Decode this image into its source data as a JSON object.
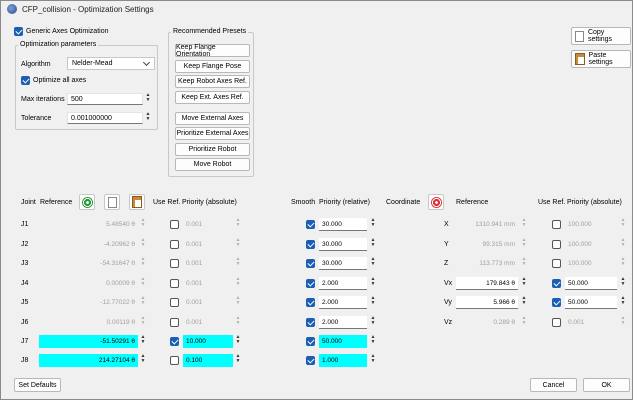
{
  "window": {
    "title": "CFP_collision - Optimization Settings"
  },
  "generic": {
    "label": "Generic Axes Optimization",
    "checked": true
  },
  "opt_params": {
    "group_label": "Optimization parameters",
    "algorithm_label": "Algorithm",
    "algorithm_value": "Nelder-Mead",
    "optimize_all_label": "Optimize all axes",
    "max_iter_label": "Max iterations",
    "max_iter_value": "500",
    "tolerance_label": "Tolerance",
    "tolerance_value": "0.001000000"
  },
  "presets": {
    "group_label": "Recommended Presets",
    "buttons": [
      "Keep Flange Orientation",
      "Keep Flange Pose",
      "Keep Robot Axes Ref.",
      "Keep Ext. Axes Ref.",
      "Move External Axes",
      "Prioritize External Axes",
      "Prioritize Robot",
      "Move Robot"
    ]
  },
  "side_buttons": {
    "copy": "Copy settings",
    "paste": "Paste settings"
  },
  "joint_headers": {
    "joint": "Joint",
    "reference": "Reference",
    "use_ref": "Use Ref.",
    "priority_abs": "Priority (absolute)",
    "smooth": "Smooth",
    "priority_rel": "Priority (relative)"
  },
  "coord_headers": {
    "coordinate": "Coordinate",
    "reference": "Reference",
    "use_ref": "Use Ref.",
    "priority_abs": "Priority (absolute)"
  },
  "joints": [
    {
      "name": "J1",
      "ref": "5.48540 θ",
      "use_ref": false,
      "prio_abs": "0.001",
      "smooth": true,
      "prio_rel": "30.000",
      "active": false
    },
    {
      "name": "J2",
      "ref": "-4.20962 θ",
      "use_ref": false,
      "prio_abs": "0.001",
      "smooth": true,
      "prio_rel": "30.000",
      "active": false
    },
    {
      "name": "J3",
      "ref": "-54.31647 θ",
      "use_ref": false,
      "prio_abs": "0.001",
      "smooth": true,
      "prio_rel": "30.000",
      "active": false
    },
    {
      "name": "J4",
      "ref": "0.00009 θ",
      "use_ref": false,
      "prio_abs": "0.001",
      "smooth": true,
      "prio_rel": "2.000",
      "active": false
    },
    {
      "name": "J5",
      "ref": "-12.77022 θ",
      "use_ref": false,
      "prio_abs": "0.001",
      "smooth": true,
      "prio_rel": "2.000",
      "active": false
    },
    {
      "name": "J6",
      "ref": "0.00119 θ",
      "use_ref": false,
      "prio_abs": "0.001",
      "smooth": true,
      "prio_rel": "2.000",
      "active": false
    },
    {
      "name": "J7",
      "ref": "-51.50291 θ",
      "use_ref": true,
      "prio_abs": "10.000",
      "smooth": true,
      "prio_rel": "50.000",
      "active": true
    },
    {
      "name": "J8",
      "ref": "214.27104 θ",
      "use_ref": false,
      "prio_abs": "0.100",
      "smooth": true,
      "prio_rel": "1.000",
      "active": true
    }
  ],
  "coords": [
    {
      "name": "X",
      "ref": "1310.941 mm",
      "use_ref": false,
      "prio_abs": "100.000",
      "active": false
    },
    {
      "name": "Y",
      "ref": "99.315 mm",
      "use_ref": false,
      "prio_abs": "100.000",
      "active": false
    },
    {
      "name": "Z",
      "ref": "113.773 mm",
      "use_ref": false,
      "prio_abs": "100.000",
      "active": false
    },
    {
      "name": "Vx",
      "ref": "179.843 θ",
      "use_ref": true,
      "prio_abs": "50.000",
      "active": true
    },
    {
      "name": "Vy",
      "ref": "5.966 θ",
      "use_ref": true,
      "prio_abs": "50.000",
      "active": true
    },
    {
      "name": "Vz",
      "ref": "0.289 θ",
      "use_ref": false,
      "prio_abs": "0.001",
      "active": false
    }
  ],
  "footer": {
    "set_defaults": "Set Defaults",
    "cancel": "Cancel",
    "ok": "OK"
  }
}
